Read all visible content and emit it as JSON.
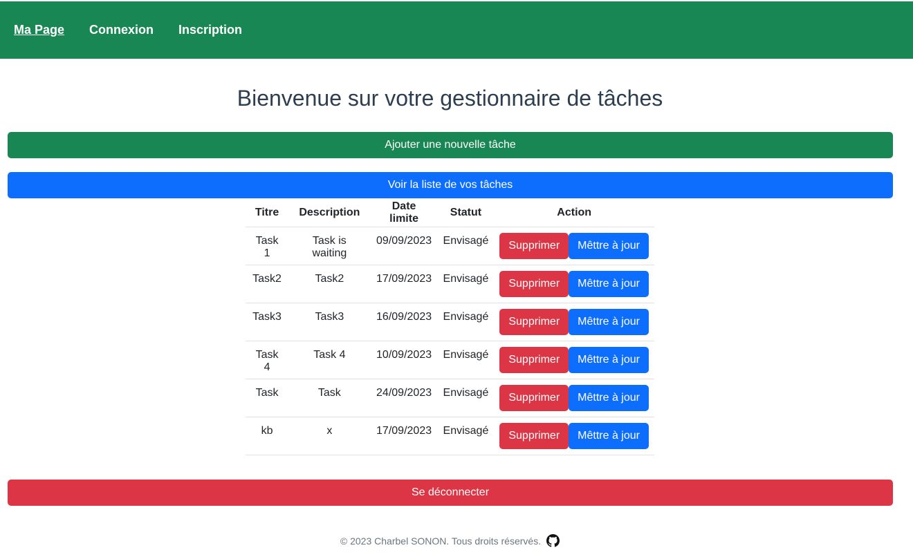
{
  "nav": {
    "brand": "Ma Page",
    "login": "Connexion",
    "signup": "Inscription"
  },
  "main": {
    "title": "Bienvenue sur votre gestionnaire de tâches",
    "add_button": "Ajouter une nouvelle tâche",
    "list_button": "Voir la liste de vos tâches",
    "logout_button": "Se déconnecter"
  },
  "table": {
    "headers": [
      "Titre",
      "Description",
      "Date limite",
      "Statut",
      "Action"
    ],
    "delete_label": "Supprimer",
    "update_label": "Mêttre à jour",
    "rows": [
      {
        "title": "Task 1",
        "description": "Task is waiting",
        "deadline": "09/09/2023",
        "status": "Envisagé"
      },
      {
        "title": "Task2",
        "description": "Task2",
        "deadline": "17/09/2023",
        "status": "Envisagé"
      },
      {
        "title": "Task3",
        "description": "Task3",
        "deadline": "16/09/2023",
        "status": "Envisagé"
      },
      {
        "title": "Task 4",
        "description": "Task 4",
        "deadline": "10/09/2023",
        "status": "Envisagé"
      },
      {
        "title": "Task",
        "description": "Task",
        "deadline": "24/09/2023",
        "status": "Envisagé"
      },
      {
        "title": "kb",
        "description": "x",
        "deadline": "17/09/2023",
        "status": "Envisagé"
      }
    ]
  },
  "footer": {
    "text": "© 2023 Charbel SONON. Tous droits réservés.",
    "icon": "github-icon"
  },
  "colors": {
    "green": "#198754",
    "blue": "#0d6efd",
    "red": "#dc3545"
  }
}
